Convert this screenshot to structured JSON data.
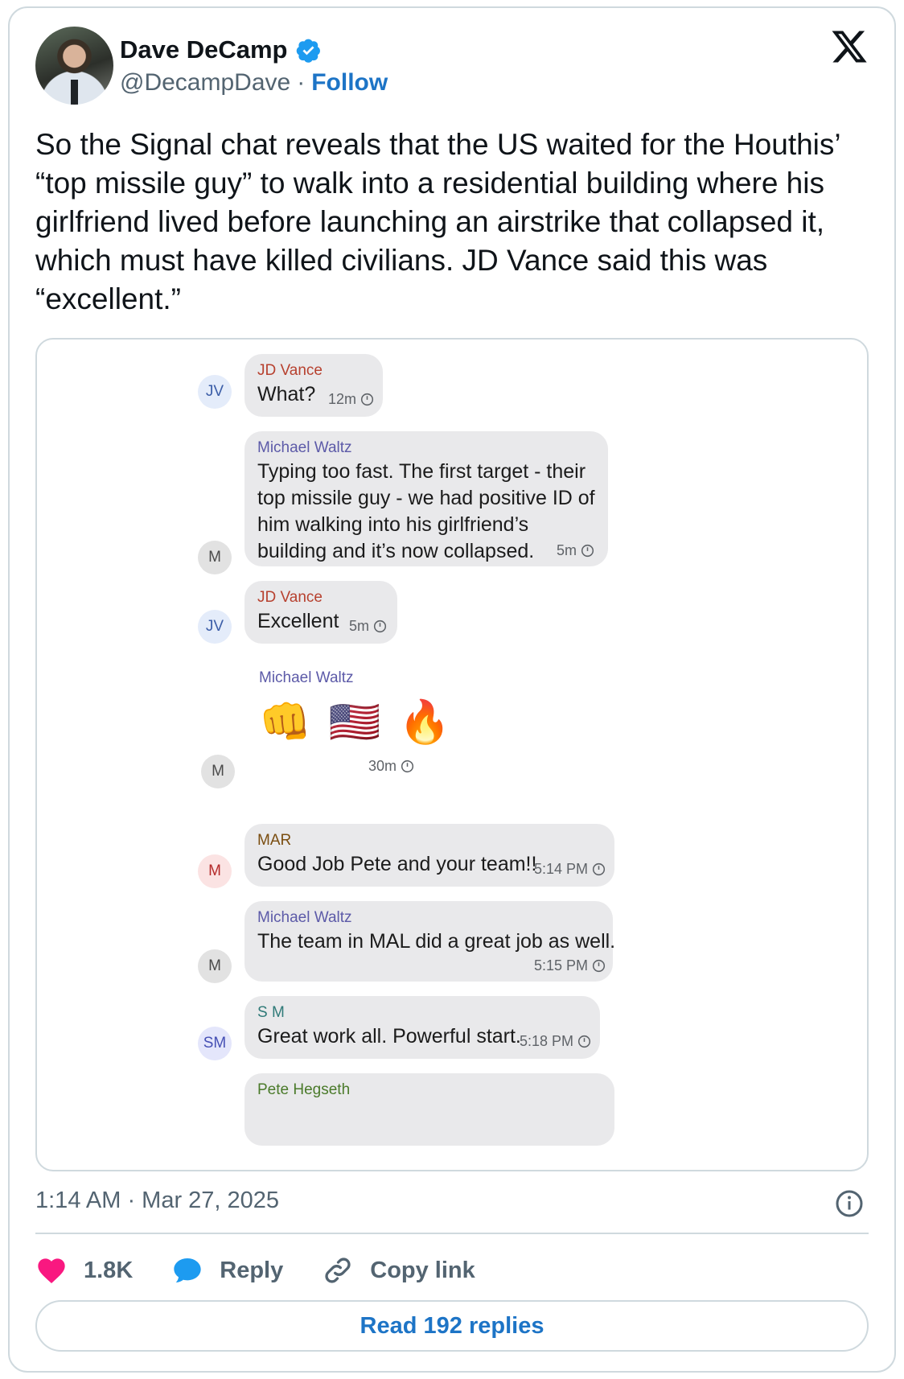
{
  "author": {
    "display_name": "Dave DeCamp",
    "handle": "@DecampDave",
    "separator": "·",
    "follow_label": "Follow"
  },
  "tweet": {
    "text": "So the Signal chat reveals that the US waited for the Houthis’ “top missile guy” to walk into a residential building where his girlfriend lived before launching an airstrike that collapsed it, which must have killed civilians. JD Vance said this was “excellent.”",
    "timestamp": "1:14 AM · Mar 27, 2025"
  },
  "chat": {
    "messages": [
      {
        "sender": "JD Vance",
        "avatar": "JV",
        "text": "What?",
        "time": "12m"
      },
      {
        "sender": "Michael Waltz",
        "avatar": "M",
        "text": "Typing too fast. The first target - their top missile guy - we had positive ID of him walking into his girlfriend’s building and it’s now collapsed.",
        "time": "5m"
      },
      {
        "sender": "JD Vance",
        "avatar": "JV",
        "text": "Excellent",
        "time": "5m"
      },
      {
        "sender": "Michael Waltz",
        "avatar": "M",
        "text": "👊🇺🇸🔥",
        "time": "30m"
      },
      {
        "sender": "MAR",
        "avatar": "M",
        "text": "Good Job Pete and your team!!",
        "time": "5:14 PM"
      },
      {
        "sender": "Michael Waltz",
        "avatar": "M",
        "text": "The team in MAL did a great job  as well.",
        "time": "5:15 PM"
      },
      {
        "sender": "S M",
        "avatar": "SM",
        "text": "Great work all. Powerful start.",
        "time": "5:18 PM"
      },
      {
        "sender": "Pete Hegseth",
        "avatar": "",
        "text": "",
        "time": ""
      }
    ],
    "emojis": [
      "👊",
      "🇺🇸",
      "🔥"
    ]
  },
  "engagement": {
    "likes": "1.8K",
    "reply_label": "Reply",
    "copy_link_label": "Copy link",
    "read_replies_label": "Read 192 replies"
  },
  "colors": {
    "brand_blue": "#1d74c6",
    "like_pink": "#f91880",
    "reply_blue": "#1d9bf0",
    "bubble_gray": "#e9e9eb"
  },
  "icons": [
    "verified-badge-icon",
    "x-logo-icon",
    "info-icon",
    "heart-icon",
    "reply-bubble-icon",
    "link-icon",
    "clock-icon"
  ]
}
